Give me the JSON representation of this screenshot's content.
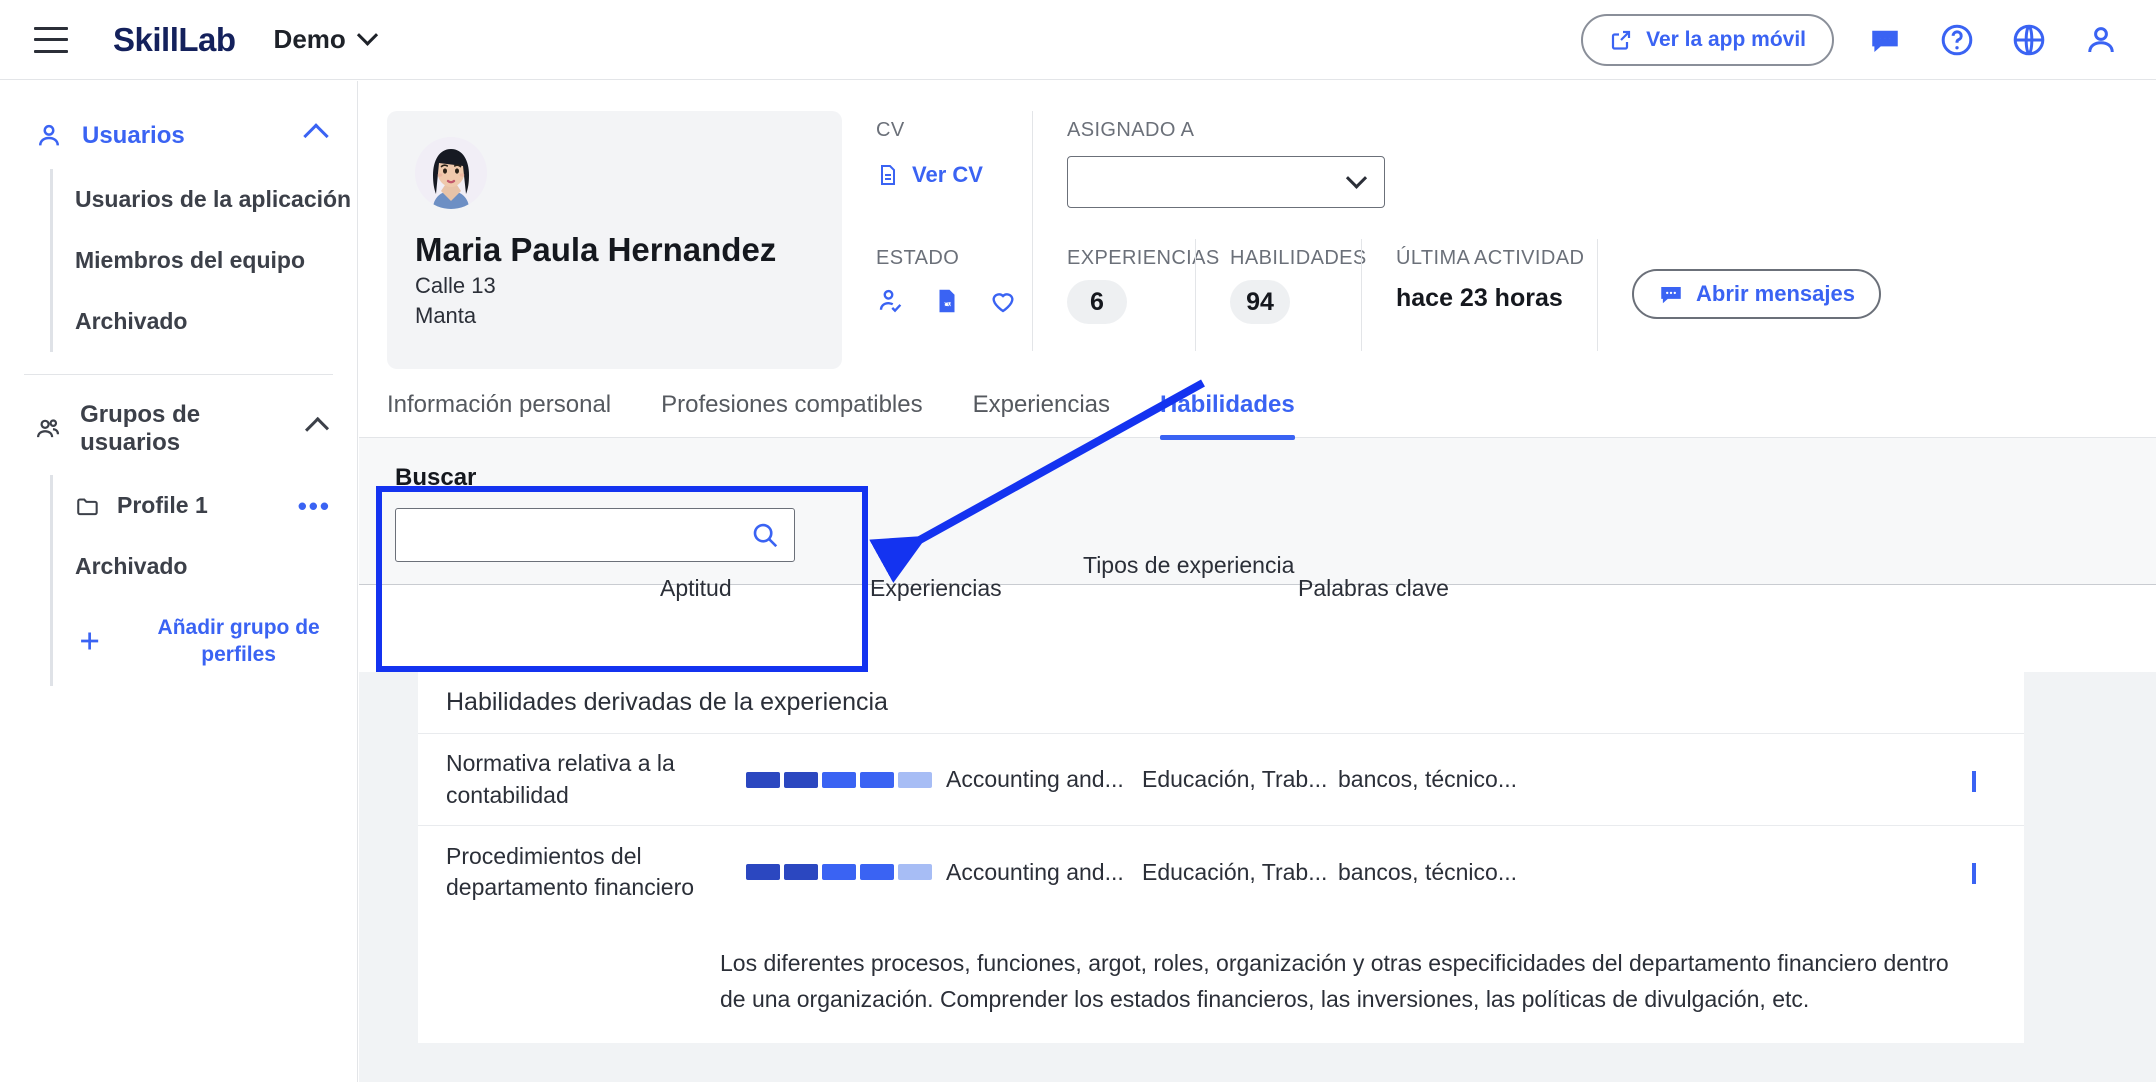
{
  "topbar": {
    "menu_icon": "hamburger-icon",
    "brand": "SkillLab",
    "workspace": "Demo",
    "mobile_app_button": "Ver la app móvil",
    "icons": [
      "chat-icon",
      "help-icon",
      "globe-icon",
      "account-icon"
    ]
  },
  "sidebar": {
    "sections": [
      {
        "label": "Usuarios",
        "icon": "user-icon",
        "active": true,
        "expanded": true,
        "items": [
          {
            "label": "Usuarios de la aplicación"
          },
          {
            "label": "Miembros del equipo"
          },
          {
            "label": "Archivado"
          }
        ]
      },
      {
        "label": "Grupos de usuarios",
        "icon": "users-group-icon",
        "active": false,
        "expanded": true,
        "items": [
          {
            "label": "Profile 1",
            "icon": "folder-icon",
            "menu": "•••"
          },
          {
            "label": "Archivado"
          }
        ],
        "add_label": "Añadir grupo de perfiles"
      }
    ]
  },
  "profile": {
    "avatar_icon": "woman-avatar",
    "name": "Maria Paula Hernandez",
    "address": "Calle 13",
    "city": "Manta"
  },
  "info": {
    "cv_label": "CV",
    "cv_link": "Ver CV",
    "assigned_label": "ASIGNADO A",
    "assigned_value": "",
    "estado_label": "ESTADO",
    "estado_icons": [
      "person-check-icon",
      "cv-document-icon",
      "heart-icon"
    ],
    "experiencias_label": "EXPERIENCIAS",
    "experiencias_count": "6",
    "habilidades_label": "HABILIDADES",
    "habilidades_count": "94",
    "actividad_label": "ÚLTIMA ACTIVIDAD",
    "actividad_value": "hace 23 horas",
    "messages_button": "Abrir mensajes"
  },
  "tabs": [
    {
      "label": "Información personal",
      "active": false
    },
    {
      "label": "Profesiones compatibles",
      "active": false
    },
    {
      "label": "Experiencias",
      "active": false
    },
    {
      "label": "Habilidades",
      "active": true
    }
  ],
  "search": {
    "label": "Buscar",
    "value": "",
    "placeholder": "",
    "icon": "search-icon"
  },
  "table": {
    "columns": [
      "Aptitud",
      "Experiencias",
      "Tipos de experiencia",
      "Palabras clave"
    ],
    "group_label": "Habilidades derivadas de la experiencia",
    "rows": [
      {
        "aptitud": "Normativa relativa a la contabilidad",
        "level": 4,
        "max_level": 5,
        "experiencias": "Accounting and...",
        "tipos": "Educación, Trab...",
        "palabras": "bancos, técnico...",
        "expanded": false,
        "chevron": "chevron-down-icon"
      },
      {
        "aptitud": "Procedimientos del departamento financiero",
        "level": 4,
        "max_level": 5,
        "experiencias": "Accounting and...",
        "tipos": "Educación, Trab...",
        "palabras": "bancos, técnico...",
        "expanded": true,
        "chevron": "chevron-up-icon",
        "description": "Los diferentes procesos, funciones, argot, roles, organización y otras especificidades del departamento financiero dentro de una organización. Comprender los estados financieros, las inversiones, las políticas de divulgación, etc."
      }
    ]
  },
  "annotation": {
    "highlight_color": "#1433f0",
    "target": "search-input"
  },
  "colors": {
    "accent": "#3a63f3",
    "brand": "#14215c",
    "bar_dark": "#2b47c0",
    "bar_mid": "#3a63f3",
    "bar_light": "#a7bdf5"
  }
}
